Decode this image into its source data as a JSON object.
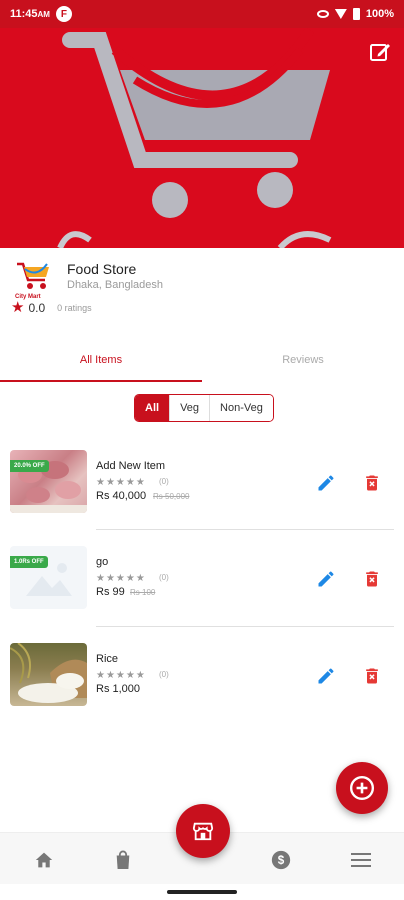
{
  "status_bar": {
    "time": "11:45",
    "time_suffix": "AM",
    "app_indicator": "F",
    "battery": "100%"
  },
  "store": {
    "logo_text": "City Mart",
    "name": "Food Store",
    "address": "Dhaka, Bangladesh",
    "rating": "0.0",
    "rating_count": "0 ratings"
  },
  "tabs": [
    {
      "label": "All Items",
      "active": true
    },
    {
      "label": "Reviews",
      "active": false
    }
  ],
  "filter": {
    "options": [
      "All",
      "Veg",
      "Non-Veg"
    ],
    "selected": "All"
  },
  "items": [
    {
      "name": "Add New Item",
      "badge": "20.0% OFF",
      "stars": "★★★★★",
      "reviews": "(0)",
      "price": "Rs 40,000",
      "old_price": "Rs 50,000",
      "image": "meat-image"
    },
    {
      "name": "go",
      "badge": "1.0Rs OFF",
      "stars": "★★★★★",
      "reviews": "(0)",
      "price": "Rs 99",
      "old_price": "Rs 100",
      "image": "placeholder-image"
    },
    {
      "name": "Rice",
      "badge": "",
      "stars": "★★★★★",
      "reviews": "(0)",
      "price": "Rs 1,000",
      "old_price": "",
      "image": "rice-image"
    }
  ],
  "bottom_nav": {
    "items": [
      "home-icon",
      "bag-icon",
      "store-icon",
      "dollar-icon",
      "menu-icon"
    ]
  },
  "colors": {
    "primary": "#c8101d",
    "banner": "#d90a1d",
    "badge": "#3aa94a",
    "edit": "#1e88e5"
  }
}
